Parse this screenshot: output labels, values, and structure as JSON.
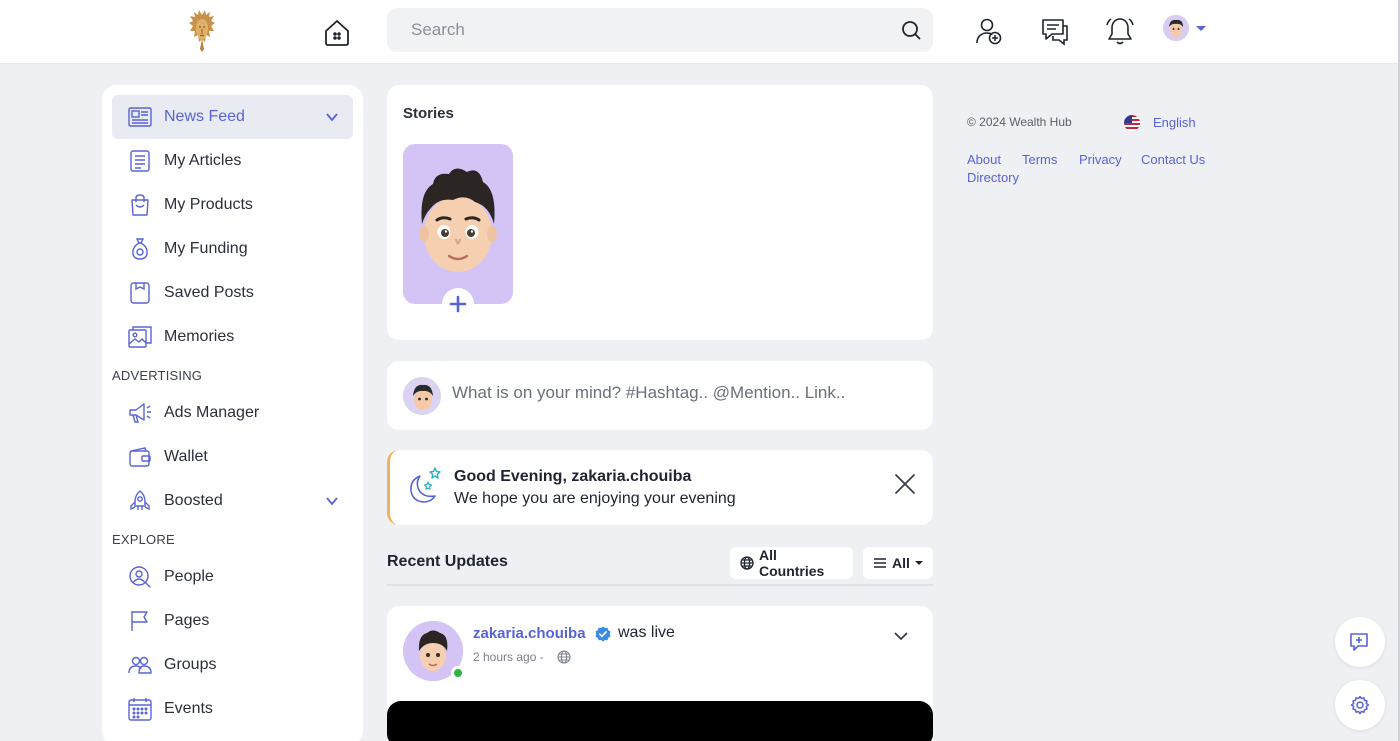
{
  "brand": {
    "logo_icon": "lion-logo-icon"
  },
  "colors": {
    "accent": "#5863d8",
    "story_bg": "#d4c4f5",
    "online": "#2fb344",
    "greeting_border": "#f0b35a"
  },
  "header": {
    "search_placeholder": "Search",
    "icons": [
      "home-icon",
      "search-icon",
      "add-friend-icon",
      "messages-icon",
      "notifications-icon",
      "avatar"
    ]
  },
  "sidebar": {
    "items": [
      {
        "label": "News Feed",
        "icon": "newspaper-icon",
        "active": true
      },
      {
        "label": "My Articles",
        "icon": "document-icon"
      },
      {
        "label": "My Products",
        "icon": "shopping-bag-icon"
      },
      {
        "label": "My Funding",
        "icon": "money-bag-icon"
      },
      {
        "label": "Saved Posts",
        "icon": "bookmark-icon"
      },
      {
        "label": "Memories",
        "icon": "photos-icon"
      }
    ],
    "advertising_heading": "ADVERTISING",
    "advertising": [
      {
        "label": "Ads Manager",
        "icon": "megaphone-icon"
      },
      {
        "label": "Wallet",
        "icon": "wallet-icon"
      },
      {
        "label": "Boosted",
        "icon": "rocket-icon"
      }
    ],
    "explore_heading": "EXPLORE",
    "explore": [
      {
        "label": "People",
        "icon": "people-search-icon"
      },
      {
        "label": "Pages",
        "icon": "flag-icon"
      },
      {
        "label": "Groups",
        "icon": "group-icon"
      },
      {
        "label": "Events",
        "icon": "calendar-icon"
      }
    ]
  },
  "stories": {
    "title": "Stories"
  },
  "composer": {
    "placeholder": "What is on your mind? #Hashtag.. @Mention.. Link.."
  },
  "greeting": {
    "title": "Good Evening, zakaria.chouiba",
    "subtitle": "We hope you are enjoying your evening"
  },
  "recent": {
    "title": "Recent Updates",
    "countries_filter": "All Countries",
    "type_filter": "All"
  },
  "post": {
    "author": "zakaria.chouiba",
    "action": "was live",
    "time": "2 hours ago -"
  },
  "footer": {
    "copyright": "© 2024 Wealth Hub",
    "language": "English",
    "links": [
      "About",
      "Terms",
      "Privacy",
      "Contact Us",
      "Directory"
    ]
  }
}
